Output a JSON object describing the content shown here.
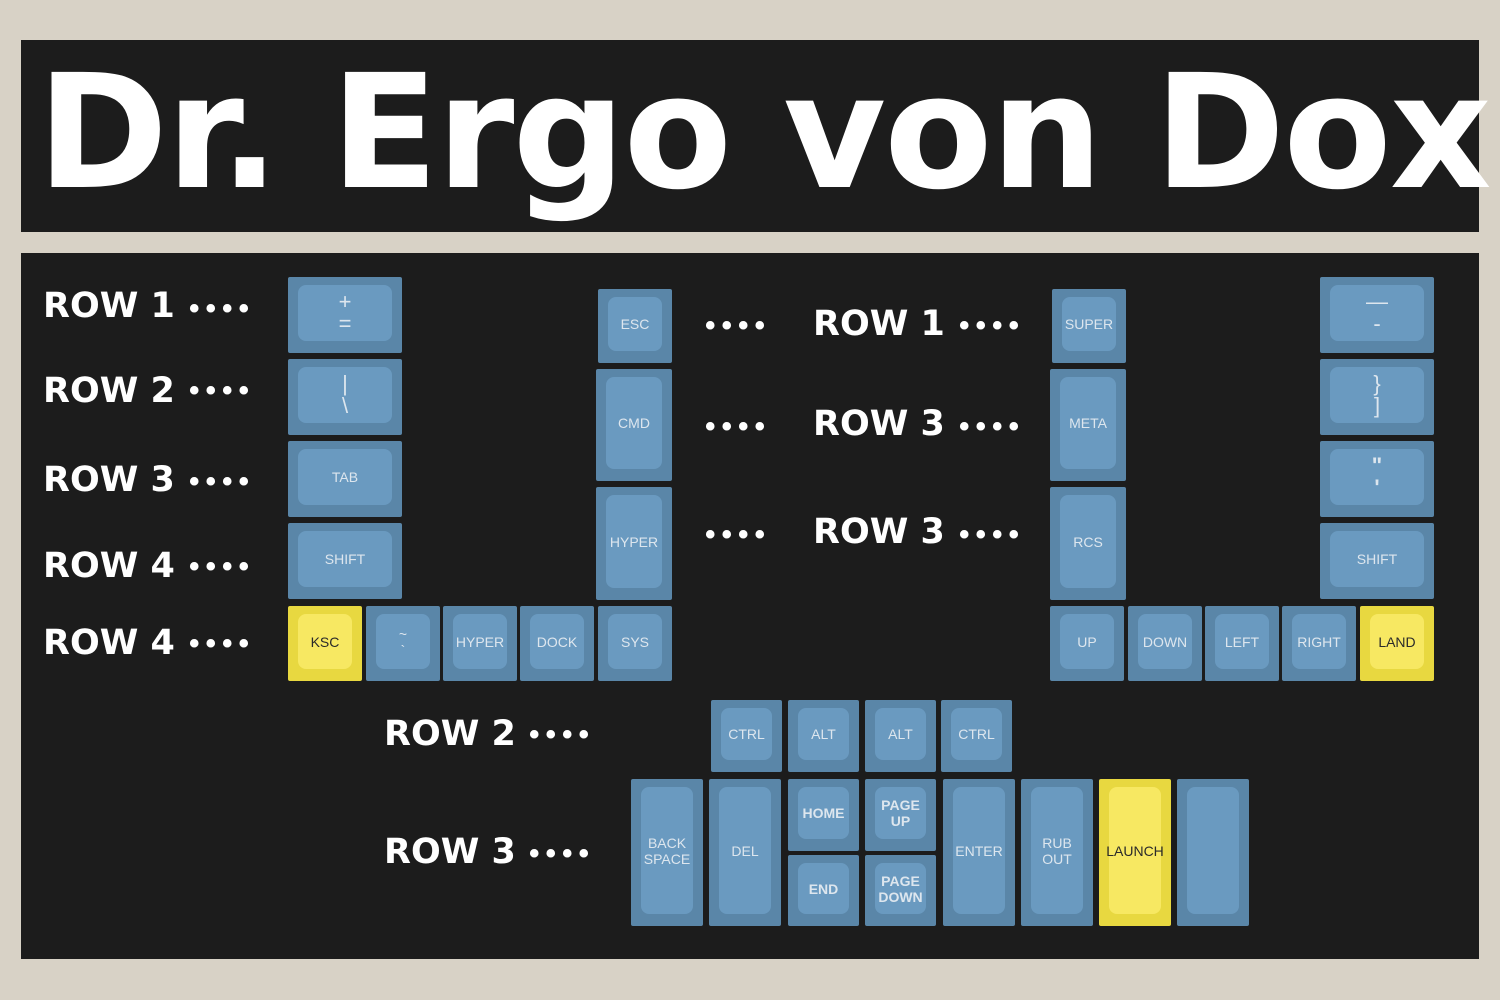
{
  "colors": {
    "background": "#d8d2c6",
    "panel": "#1c1c1c",
    "key_outer": "#5a86a8",
    "key_inner": "#6a9ac0",
    "key_yellow_outer": "#e8d840",
    "key_yellow_inner": "#f7e862"
  },
  "title": "Dr. Ergo von Dox",
  "dots": "••••",
  "row_labels": {
    "left_r1": "ROW 1",
    "left_r2": "ROW 2",
    "left_r3": "ROW 3",
    "left_r4a": "ROW 4",
    "left_r4b": "ROW 4",
    "mid_r1": "ROW 1",
    "mid_r3a": "ROW 3",
    "mid_r3b": "ROW 3",
    "thumb_r2": "ROW 2",
    "thumb_r3": "ROW 3"
  },
  "keys": {
    "plus": [
      "+",
      "="
    ],
    "pipe": [
      "|",
      "\\"
    ],
    "tab": "TAB",
    "shift_l": "SHIFT",
    "ksc": "KSC",
    "tilde": [
      "~",
      "`"
    ],
    "hyper_b": "HYPER",
    "dock": "DOCK",
    "sys": "SYS",
    "esc": "ESC",
    "cmd": "CMD",
    "hyper_l": "HYPER",
    "super": "SUPER",
    "meta": "META",
    "rcs": "RCS",
    "minus": [
      "—",
      "-"
    ],
    "brace": [
      "}",
      "]"
    ],
    "quote": [
      "\"",
      "'"
    ],
    "shift_r": "SHIFT",
    "up": "UP",
    "down": "DOWN",
    "left": "LEFT",
    "right": "RIGHT",
    "land": "LAND",
    "ctrl_l": "CTRL",
    "alt_l": "ALT",
    "alt_r": "ALT",
    "ctrl_r": "CTRL",
    "backspace": [
      "BACK",
      "SPACE"
    ],
    "del": "DEL",
    "home": "HOME",
    "pageup": [
      "PAGE",
      "UP"
    ],
    "end": "END",
    "pagedown": [
      "PAGE",
      "DOWN"
    ],
    "enter": "ENTER",
    "rubout": [
      "RUB",
      "OUT"
    ],
    "launch": "LAUNCH",
    "blank": ""
  }
}
